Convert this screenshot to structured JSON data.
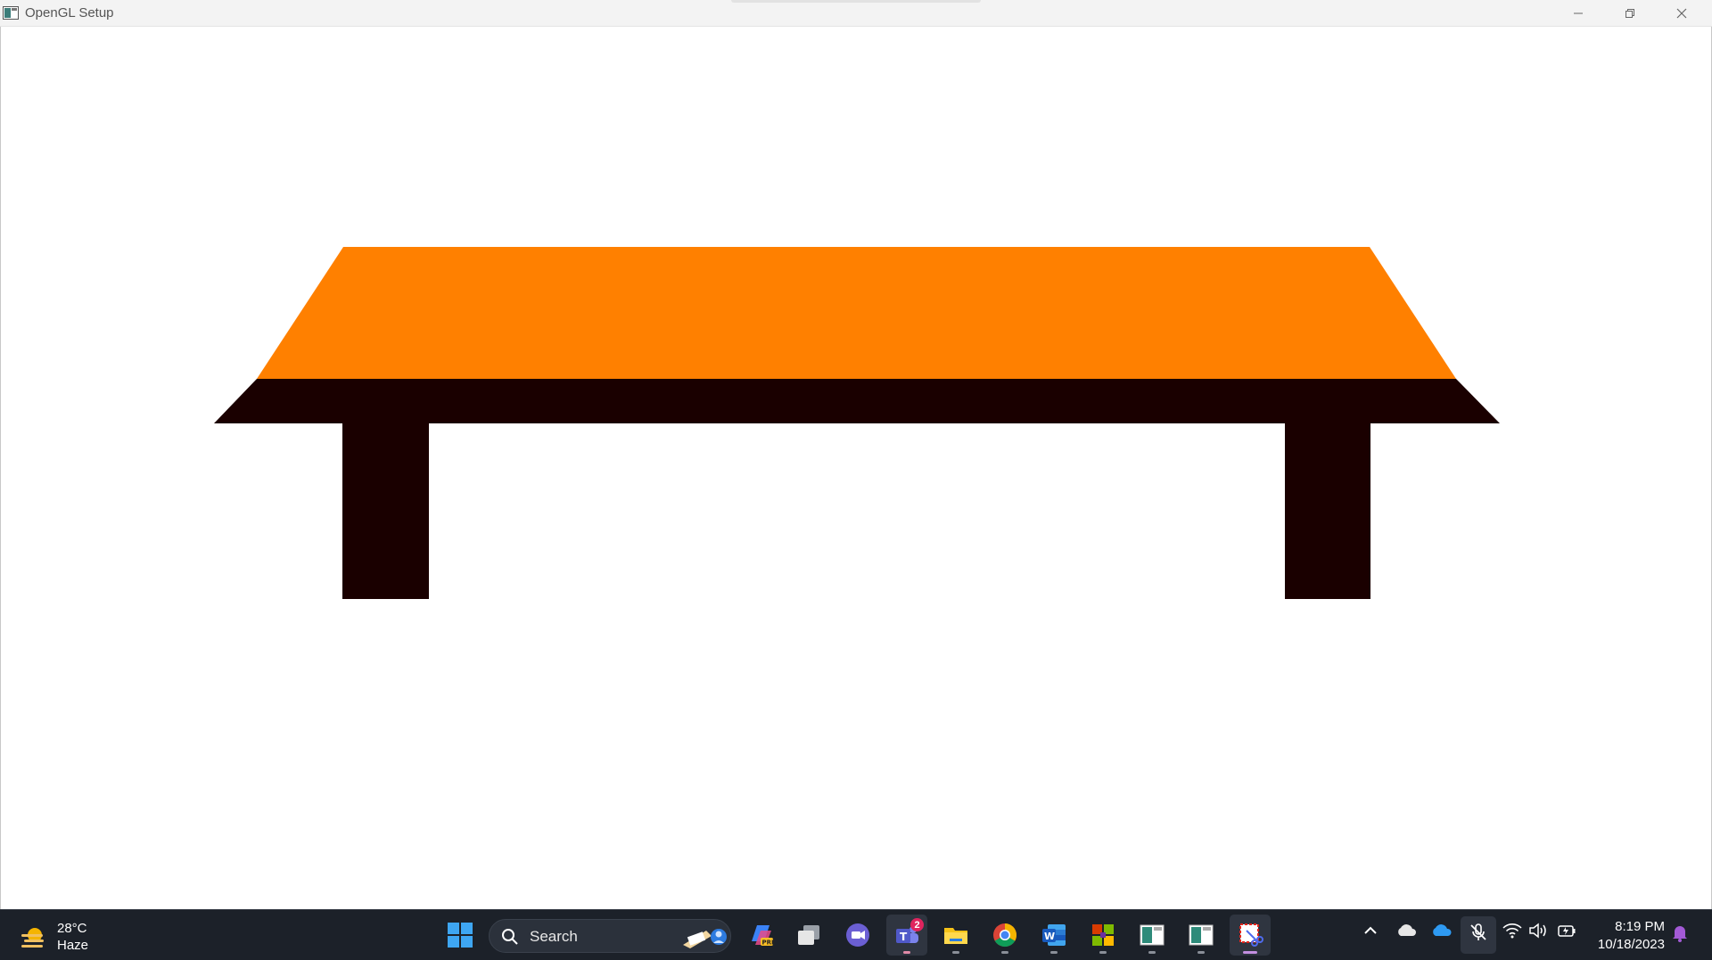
{
  "window": {
    "title": "OpenGL Setup",
    "icons": {
      "app": "opengl-app-icon",
      "minimize": "minimize-icon",
      "restore": "restore-icon",
      "close": "close-icon"
    }
  },
  "scene": {
    "description_colors": {
      "background": "#ffffff",
      "tabletop": "#ff8000",
      "table_body": "#1a0000"
    }
  },
  "taskbar": {
    "weather": {
      "temperature": "28°C",
      "condition": "Haze",
      "icon": "sun-haze-icon"
    },
    "search": {
      "label": "Search",
      "icon": "search-icon"
    },
    "apps": [
      {
        "name": "start",
        "icon": "windows-start-icon"
      },
      {
        "name": "copilot",
        "icon": "copilot-icon"
      },
      {
        "name": "task-view",
        "icon": "task-view-icon"
      },
      {
        "name": "meet",
        "icon": "video-chat-icon"
      },
      {
        "name": "teams",
        "icon": "teams-icon",
        "badge": "2"
      },
      {
        "name": "file-explorer",
        "icon": "folder-icon"
      },
      {
        "name": "chrome",
        "icon": "chrome-icon"
      },
      {
        "name": "word",
        "icon": "word-icon"
      },
      {
        "name": "app-tiles",
        "icon": "tiles-icon"
      },
      {
        "name": "opengl-window-1",
        "icon": "window-icon"
      },
      {
        "name": "opengl-window-2",
        "icon": "window-icon"
      },
      {
        "name": "snipping-tool",
        "icon": "snip-icon"
      }
    ],
    "tray": {
      "icons": [
        "chevron-up-icon",
        "cloud-icon",
        "onedrive-icon",
        "mic-muted-icon",
        "wifi-icon",
        "volume-icon",
        "battery-icon",
        "notification-bell-icon"
      ],
      "time": "8:19 PM",
      "date": "10/18/2023"
    },
    "colors": {
      "background": "#1c2129",
      "accent": "#c38fe0"
    }
  }
}
